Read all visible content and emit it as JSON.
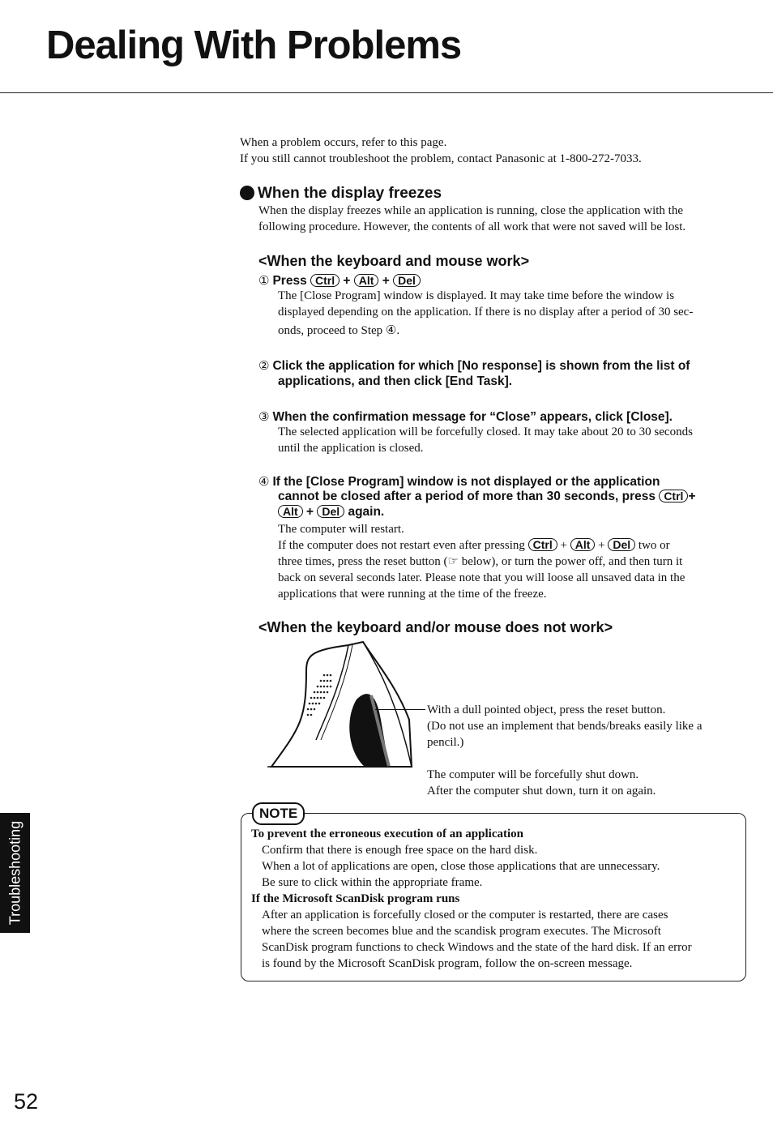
{
  "page": {
    "title": "Dealing With Problems",
    "page_number": "52",
    "side_tab": "Troubleshooting"
  },
  "intro": [
    "When a problem occurs, refer to this page.",
    "If you still cannot troubleshoot the problem, contact Panasonic at 1-800-272-7033."
  ],
  "section": {
    "heading": "When the display freezes",
    "body": [
      "When the display freezes while an application is running, close the application with the",
      "following procedure.  However, the contents of all work that were not saved will be lost."
    ]
  },
  "sub1": {
    "heading": "<When the keyboard and mouse work>",
    "steps": [
      {
        "num": "①",
        "title_prefix": "Press",
        "keys": [
          "Ctrl",
          "Alt",
          "Del"
        ],
        "body": [
          "The [Close Program] window is displayed.  It may take time before the window is",
          "displayed depending on the application.  If there is no display after a period of 30 sec-",
          "onds, proceed to Step ④."
        ]
      },
      {
        "num": "②",
        "title": [
          "Click the application for which [No response] is shown from the list of",
          "applications, and then click [End Task]."
        ]
      },
      {
        "num": "③",
        "title": [
          "When the confirmation message for “Close” appears, click [Close]."
        ],
        "body": [
          "The selected application will be forcefully closed.  It may take about 20 to 30 seconds",
          "until the application is closed."
        ]
      },
      {
        "num": "④",
        "title": [
          "If the [Close Program] window is not displayed or the application",
          "cannot be closed after a period of more than 30 seconds,  press",
          "again."
        ],
        "keys": [
          "Ctrl",
          "Alt",
          "Del"
        ],
        "body_first": "The computer will restart.",
        "body_pre": "If the computer does not restart even after pressing",
        "body_post": "two or",
        "body": [
          "three times, press the reset button (☞ below), or turn the power off, and then turn it",
          "back on several seconds later.  Please note that you will loose all unsaved data in the",
          "applications that were running at the time of the freeze."
        ]
      }
    ]
  },
  "sub2": {
    "heading": "<When the keyboard and/or mouse does not work>",
    "callout": [
      "With a dull pointed object, press the reset button.",
      "(Do not use an implement that bends/breaks easily like a",
      "pencil.)"
    ],
    "after": [
      "The computer will be forcefully shut down.",
      "After the computer shut down, turn it on again."
    ]
  },
  "note": {
    "label": "NOTE",
    "items": [
      {
        "heading": "To prevent the erroneous execution of an application",
        "lines": [
          "Confirm that there is enough free space on the hard disk.",
          "When a lot of applications are open, close those applications that are unnecessary.",
          "Be sure to click within the appropriate frame."
        ]
      },
      {
        "heading": "If the Microsoft ScanDisk program runs",
        "lines": [
          "After an application is forcefully closed or the computer is restarted, there are cases",
          "where the screen becomes blue and the scandisk program executes. The Microsoft",
          "ScanDisk program functions to check Windows and the state of the hard disk. If an error",
          "is found by the Microsoft ScanDisk program, follow the on-screen message."
        ]
      }
    ]
  }
}
